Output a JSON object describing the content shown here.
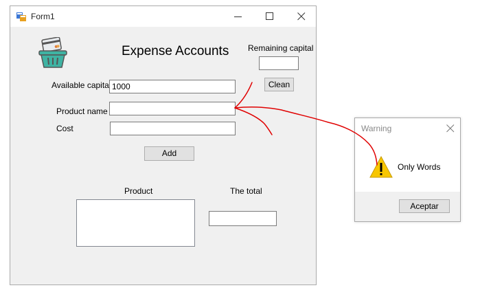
{
  "window": {
    "title": "Form1",
    "heading": "Expense Accounts",
    "remaining_capital_label": "Remaining capital",
    "remaining_capital_value": "",
    "clean_label": "Clean",
    "available_capital_label": "Available capital",
    "available_capital_value": "1000",
    "product_name_label": "Product name",
    "product_name_value": "",
    "cost_label": "Cost",
    "cost_value": "",
    "add_label": "Add",
    "product_column_label": "Product",
    "total_label": "The total",
    "total_value": ""
  },
  "dialog": {
    "title": "Warning",
    "message": "Only Words",
    "ok_label": "Aceptar"
  },
  "colors": {
    "annotation": "#e00000",
    "warning_icon": "#f7c600"
  }
}
